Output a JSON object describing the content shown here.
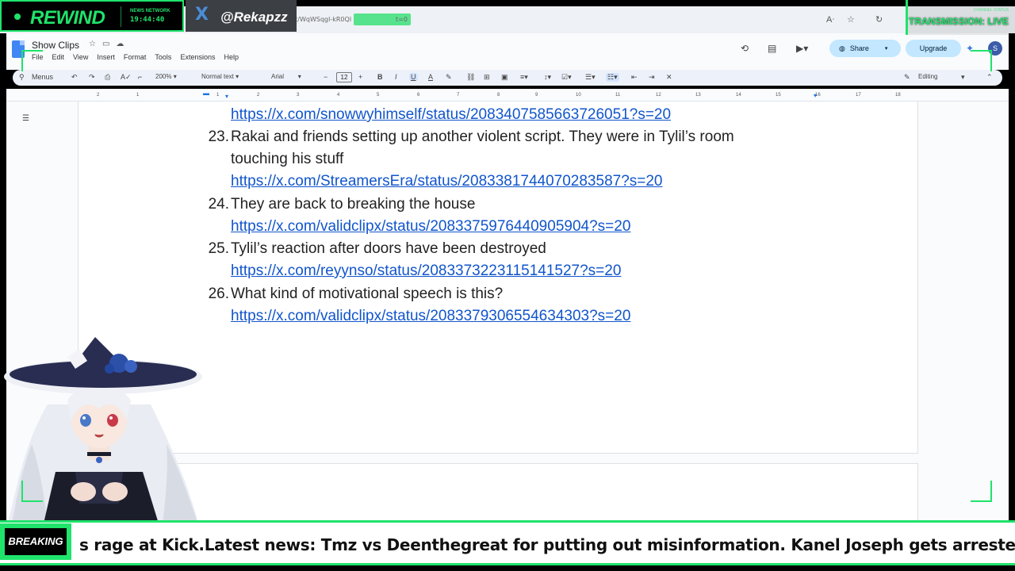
{
  "overlay": {
    "rewind_title": "REWIND",
    "news_network": "NEWS NETWORK",
    "clock": "19:44:40",
    "handle_icon": "X",
    "handle": "@Rekapzz",
    "transmission_sub": "CHANNEL STATUS",
    "transmission": "TRANSMISSION: LIVE",
    "accent_color": "#1fe36b"
  },
  "browser": {
    "url_fragment": "st/WqWSqgl-kR0Ql",
    "url_tail": "t=0"
  },
  "doc": {
    "title": "Show Clips",
    "menus": [
      "File",
      "Edit",
      "View",
      "Insert",
      "Format",
      "Tools",
      "Extensions",
      "Help"
    ],
    "share_label": "Share",
    "upgrade_label": "Upgrade",
    "avatar_initial": "S",
    "toolbar": {
      "menus_label": "Menus",
      "zoom": "200%",
      "style": "Normal text",
      "font": "Arial",
      "font_size": "12",
      "mode": "Editing"
    },
    "ruler_ticks": [
      "2",
      "1",
      "1",
      "2",
      "3",
      "4",
      "5",
      "6",
      "7",
      "8",
      "9",
      "10",
      "11",
      "12",
      "13",
      "14",
      "15",
      "16",
      "17",
      "18"
    ],
    "entries": [
      {
        "number": "",
        "lines": [],
        "link": "https://x.com/snowwyhimself/status/2083407585663726051?s=20"
      },
      {
        "number": "23.",
        "lines": [
          "Rakai and friends setting up another violent script. They were in Tylil’s room",
          "touching his stuff"
        ],
        "link": "https://x.com/StreamersEra/status/2083381744070283587?s=20"
      },
      {
        "number": "24.",
        "lines": [
          "They are back to breaking the house"
        ],
        "link": "https://x.com/validclipx/status/2083375976440905904?s=20"
      },
      {
        "number": "25.",
        "lines": [
          "Tylil’s reaction after doors have been destroyed"
        ],
        "link": "https://x.com/reyynso/status/2083373223115141527?s=20"
      },
      {
        "number": "26.",
        "lines": [
          "What kind of motivational speech is this?"
        ],
        "link": "https://x.com/validclipx/status/2083379306554634303?s=20"
      }
    ]
  },
  "ticker": {
    "badge": "BREAKING",
    "text": "s rage at Kick.Latest news: Tmz vs Deenthegreat for putting out misinformation. Kanel Joseph gets arrested tryin"
  }
}
